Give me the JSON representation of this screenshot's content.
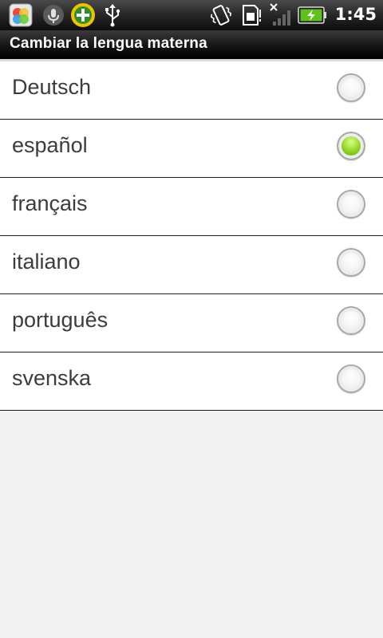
{
  "status_bar": {
    "time": "1:45",
    "icons": [
      "gallery-app-icon",
      "microphone-icon",
      "add-app-icon",
      "usb-icon",
      "vibrate-icon",
      "sd-card-icon",
      "no-signal-icon",
      "battery-charging-icon"
    ]
  },
  "title_bar": {
    "title": "Cambiar la lengua materna"
  },
  "languages": [
    {
      "label": "Deutsch",
      "selected": false
    },
    {
      "label": "español",
      "selected": true
    },
    {
      "label": "français",
      "selected": false
    },
    {
      "label": "italiano",
      "selected": false
    },
    {
      "label": "português",
      "selected": false
    },
    {
      "label": "svenska",
      "selected": false
    }
  ],
  "colors": {
    "selected_radio": "#8fd41f",
    "list_background": "#ffffff",
    "page_background": "#f2f2f2"
  }
}
